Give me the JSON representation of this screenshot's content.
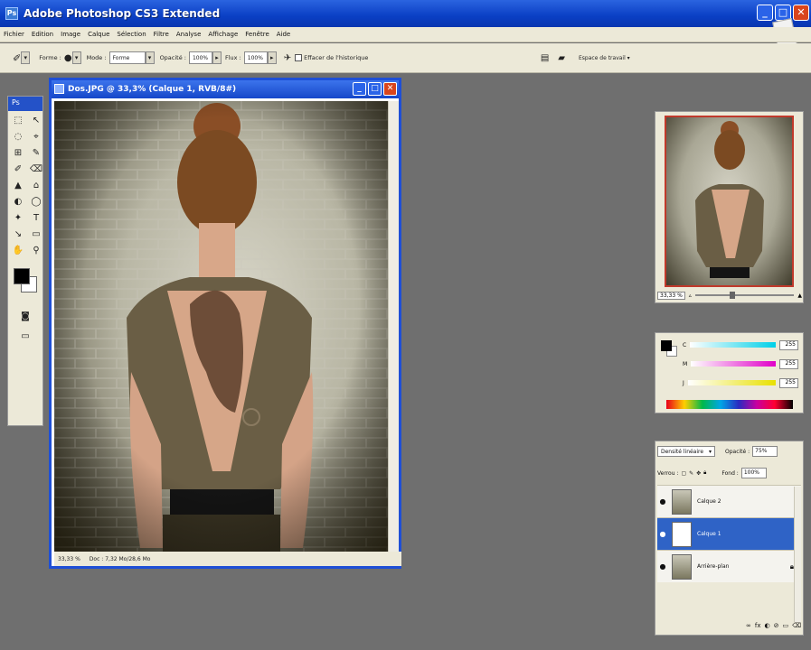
{
  "window": {
    "title": "Adobe Photoshop CS3 Extended",
    "logo": "Ps",
    "min": "_",
    "max": "□",
    "close": "✕",
    "badge": "PS"
  },
  "menu": [
    "Fichier",
    "Edition",
    "Image",
    "Calque",
    "Sélection",
    "Filtre",
    "Analyse",
    "Affichage",
    "Fenêtre",
    "Aide"
  ],
  "options": {
    "brush_label": "Forme :",
    "mode_label": "Mode :",
    "mode_value": "Forme",
    "opacity_label": "Opacité :",
    "opacity_value": "100%",
    "flow_label": "Flux :",
    "flow_value": "100%",
    "erase_history": "Effacer de l'historique",
    "workspace": "Espace de travail ▾"
  },
  "toolbar": {
    "header": "Ps",
    "tools": [
      "⬚",
      "↖",
      "◌",
      "⌖",
      "⊞",
      "✎",
      "✐",
      "⌫",
      "▲",
      "⌂",
      "◐",
      "◯",
      "✦",
      "T",
      "↘",
      "▭",
      "✋",
      "⚲"
    ]
  },
  "document": {
    "title": "Dos.JPG @ 33,3% (Calque 1, RVB/8#)",
    "zoom": "33,33 %",
    "info": "Doc : 7,32 Mo/28,6 Mo"
  },
  "navigator": {
    "zoom": "33,33 %"
  },
  "color": {
    "rows": [
      {
        "label": "C",
        "value": "255",
        "color": "#00d0e8"
      },
      {
        "label": "M",
        "value": "255",
        "color": "#e000c8"
      },
      {
        "label": "J",
        "value": "255",
        "color": "#e8e000"
      }
    ]
  },
  "layers": {
    "blend_mode": "Densité linéaire",
    "opacity_label": "Opacité :",
    "opacity_value": "75%",
    "lock_label": "Verrou :",
    "fill_label": "Fond :",
    "fill_value": "100%",
    "items": [
      {
        "name": "Calque 2",
        "active": false
      },
      {
        "name": "Calque 1",
        "active": true
      },
      {
        "name": "Arrière-plan",
        "active": false
      }
    ],
    "footer": [
      "∞",
      "fx",
      "◐",
      "⊘",
      "▭",
      "⌫"
    ]
  }
}
